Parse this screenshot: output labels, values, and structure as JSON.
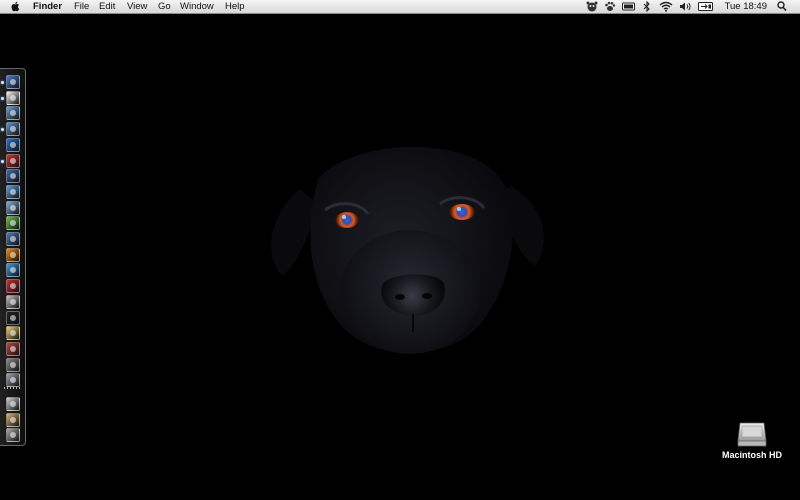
{
  "menubar": {
    "apple_icon": "apple-logo-icon",
    "app_name": "Finder",
    "menus": [
      "File",
      "Edit",
      "View",
      "Go",
      "Window",
      "Help"
    ],
    "status_icons": [
      "growl-icon",
      "paw-icon",
      "battery-badge-icon",
      "bluetooth-icon",
      "wifi-icon",
      "volume-icon",
      "input-source-icon"
    ],
    "clock": "Tue 18:49",
    "spotlight_icon": "spotlight-search-icon"
  },
  "desktop": {
    "wallpaper": "black-labrador-dog-face",
    "background_color": "#000000",
    "drive_label": "Macintosh HD"
  },
  "dock": {
    "position": "left",
    "apps": [
      {
        "name": "finder",
        "color": "#4a7fd4",
        "running": true
      },
      {
        "name": "adium",
        "color": "#f2f2f2",
        "running": true
      },
      {
        "name": "camino",
        "color": "#6aa0d8",
        "running": false
      },
      {
        "name": "preview",
        "color": "#5e8fcf",
        "running": true
      },
      {
        "name": "word",
        "color": "#2f6fd0",
        "running": false
      },
      {
        "name": "magnet",
        "color": "#d03030",
        "running": true
      },
      {
        "name": "steam",
        "color": "#3a6ab0",
        "running": false
      },
      {
        "name": "safari",
        "color": "#5aa0e0",
        "running": false
      },
      {
        "name": "system-tools",
        "color": "#7ab0d8",
        "running": false
      },
      {
        "name": "itunes",
        "color": "#6ac04a",
        "running": false
      },
      {
        "name": "iphoto",
        "color": "#4a7ab8",
        "running": false
      },
      {
        "name": "vlc",
        "color": "#f08a10",
        "running": false
      },
      {
        "name": "quicktime",
        "color": "#3a9ae0",
        "running": false
      },
      {
        "name": "flashcards",
        "color": "#c83030",
        "running": false
      },
      {
        "name": "screenshot",
        "color": "#c0c0c0",
        "running": false
      },
      {
        "name": "terminal",
        "color": "#222222",
        "running": false
      },
      {
        "name": "weather",
        "color": "#f0d070",
        "running": false
      },
      {
        "name": "migration",
        "color": "#c04040",
        "running": false
      },
      {
        "name": "disk-utility",
        "color": "#888888",
        "running": false
      },
      {
        "name": "system-prefs",
        "color": "#9aa0b0",
        "running": false
      },
      {
        "name": "downloads",
        "color": "#cfcfcf",
        "running": false
      },
      {
        "name": "documents",
        "color": "#d8b070",
        "running": false
      },
      {
        "name": "trash",
        "color": "#a8a8a8",
        "running": false
      }
    ]
  }
}
